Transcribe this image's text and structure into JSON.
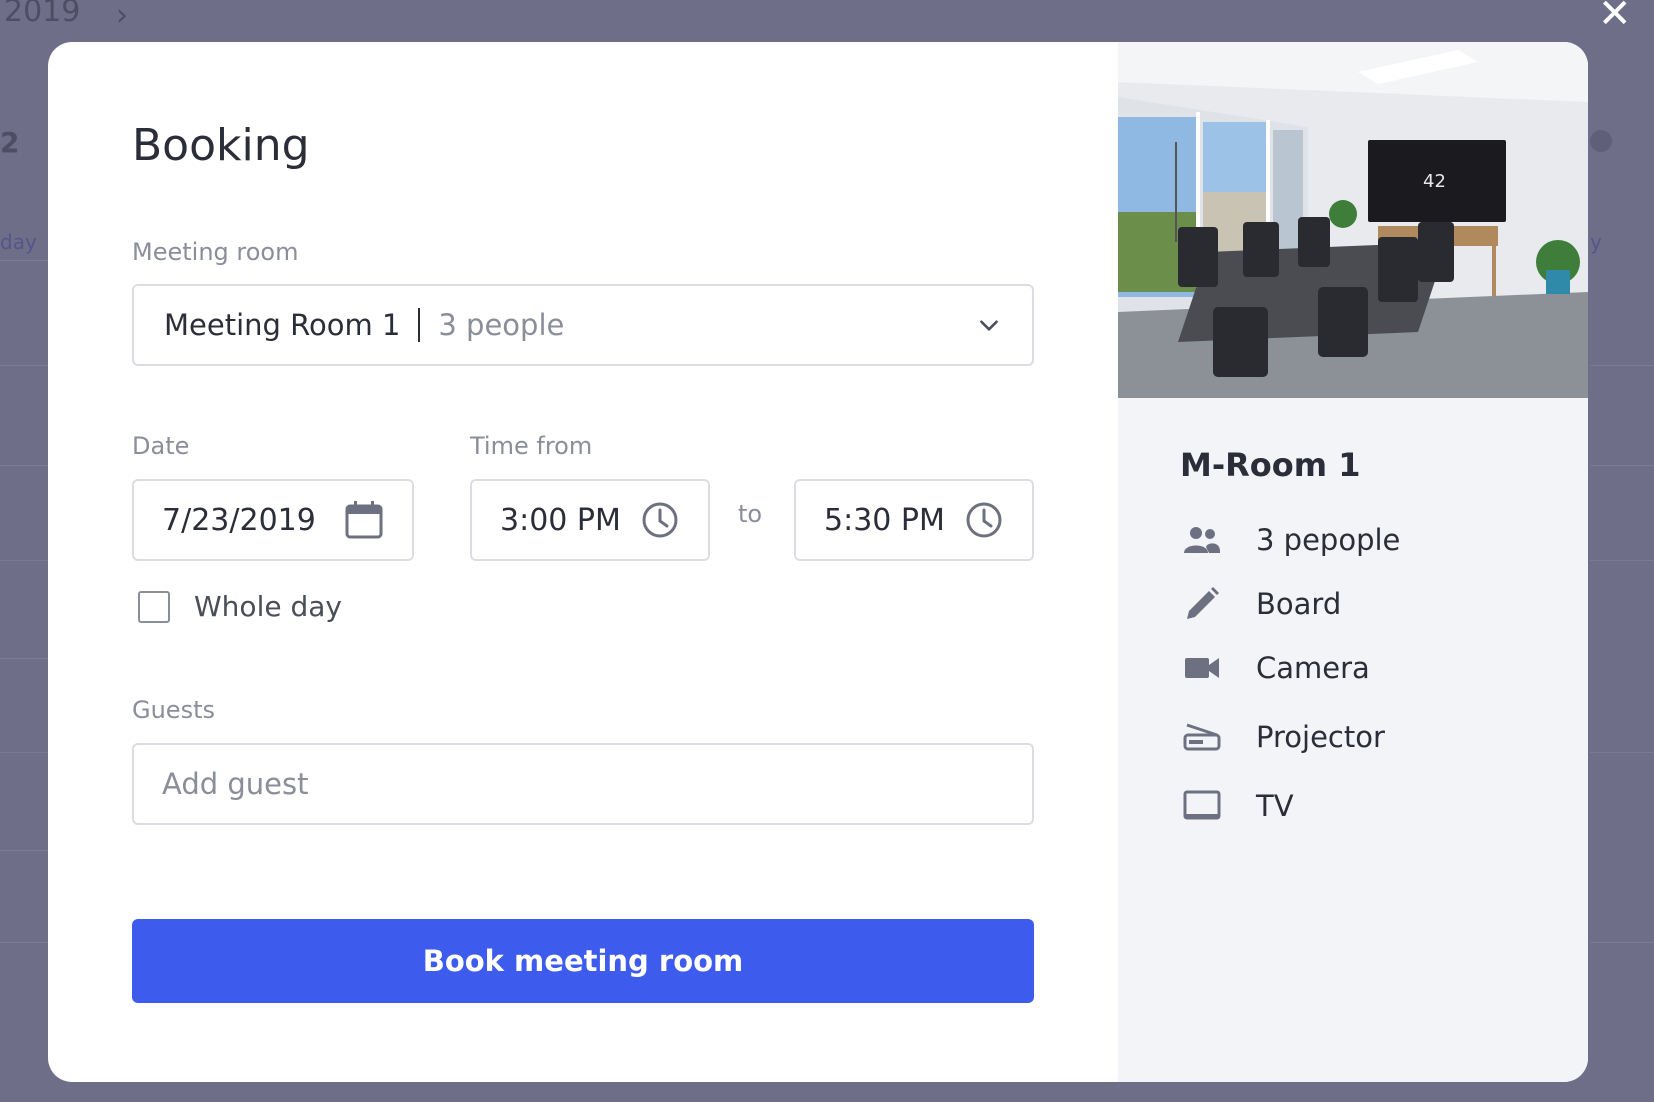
{
  "background": {
    "year": "2019",
    "number": "2",
    "day_text": "day",
    "right_text": "y"
  },
  "modal": {
    "title": "Booking",
    "meeting_room": {
      "label": "Meeting room",
      "selected_name": "Meeting Room 1",
      "selected_capacity": "3 people"
    },
    "date": {
      "label": "Date",
      "value": "7/23/2019"
    },
    "time": {
      "label": "Time from",
      "from": "3:00 PM",
      "separator": "to",
      "to": "5:30 PM"
    },
    "whole_day": {
      "label": "Whole day",
      "checked": false
    },
    "guests": {
      "label": "Guests",
      "placeholder": "Add guest",
      "value": ""
    },
    "submit_label": "Book meeting room"
  },
  "room_panel": {
    "name": "M-Room 1",
    "tv_screen_text": "42",
    "amenities": [
      {
        "icon": "people-icon",
        "label": "3 pepople"
      },
      {
        "icon": "pencil-icon",
        "label": "Board"
      },
      {
        "icon": "camera-icon",
        "label": "Camera"
      },
      {
        "icon": "projector-icon",
        "label": "Projector"
      },
      {
        "icon": "tv-icon",
        "label": "TV"
      }
    ]
  },
  "colors": {
    "overlay": "#6e6e88",
    "primary": "#3d5bec",
    "panel_bg": "#f3f4f8",
    "text": "#2b2e38",
    "muted": "#8a8e99",
    "border": "#dcdde2"
  }
}
